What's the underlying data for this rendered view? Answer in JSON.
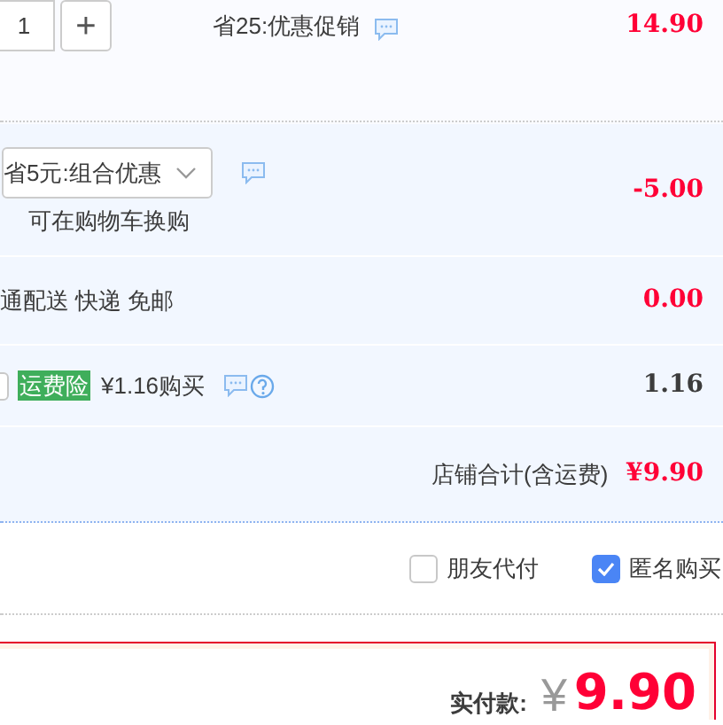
{
  "item": {
    "quantity": "1",
    "plus": "+",
    "promotion": "省25:优惠促销",
    "price": "14.90"
  },
  "combo": {
    "select": "省5元:组合优惠",
    "note": "可在购物车换购",
    "amount": "-5.00"
  },
  "shipping": {
    "text": "通配送 快递 免邮",
    "amount": "0.00"
  },
  "insurance": {
    "checked": false,
    "badge": "运费险",
    "text": "¥1.16购买",
    "amount": "1.16"
  },
  "store_total": {
    "label": "店铺合计(含运费)",
    "amount": "¥9.90"
  },
  "options": [
    {
      "label": "朋友代付",
      "checked": false
    },
    {
      "label": "匿名购买",
      "checked": true
    }
  ],
  "payment": {
    "label": "实付款:",
    "currency": "¥",
    "amount": "9.90"
  }
}
